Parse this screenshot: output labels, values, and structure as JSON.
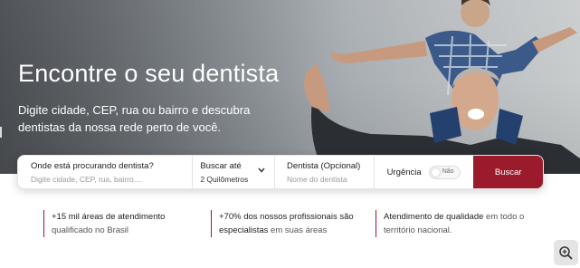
{
  "hero": {
    "title": "Encontre o seu dentista",
    "subtitle": "Digite cidade, CEP, rua ou bairro e descubra dentistas da nossa rede perto de você."
  },
  "search": {
    "where_label": "Onde está procurando dentista?",
    "where_placeholder": "Digite cidade, CEP, rua, bairro....",
    "distance_label": "Buscar até",
    "distance_value": "2 Quilômetros",
    "dentist_label": "Dentista (Opcional)",
    "dentist_placeholder": "Nome do dentista",
    "urgency_label": "Urgência",
    "urgency_toggle_text": "Não",
    "button_label": "Buscar"
  },
  "features": [
    {
      "strong": "+15 mil áreas de atendimento",
      "rest": "qualificado no Brasil"
    },
    {
      "strong": "+70% dos nossos profissionais são especialistas",
      "rest": " em suas áreas"
    },
    {
      "strong": "Atendimento de qualidade",
      "rest": " em todo o território nacional."
    }
  ],
  "icons": {
    "zoom": "zoom-in-icon",
    "chevron": "chevron-down-icon"
  },
  "colors": {
    "accent": "#9b1b2c"
  }
}
